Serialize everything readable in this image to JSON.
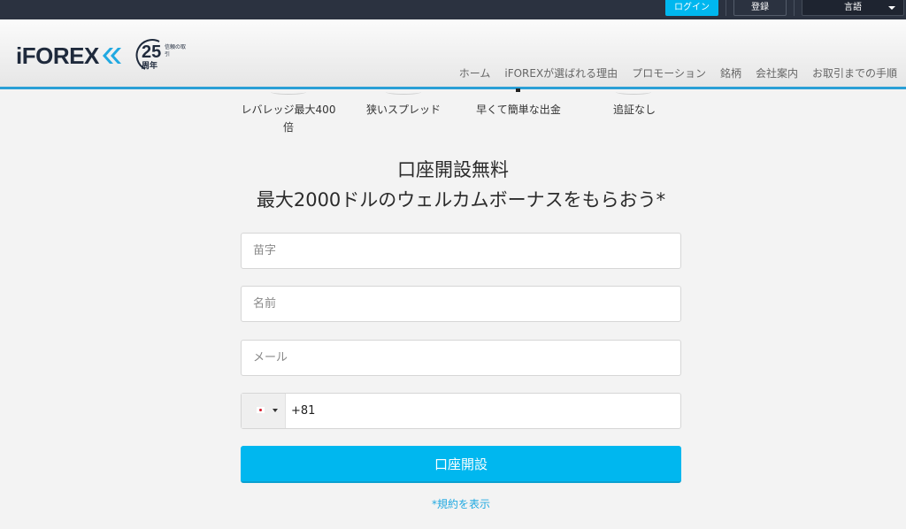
{
  "topbar": {
    "login_label": "ログイン",
    "register_label": "登録",
    "language_label": "言語"
  },
  "header": {
    "logo_text": "iFOREX",
    "badge_number": "25",
    "badge_sub": "周年",
    "badge_side": "信頼の取引",
    "nav": [
      "ホーム",
      "iFOREXが選ばれる理由",
      "プロモーション",
      "銘柄",
      "会社案内",
      "お取引までの手順"
    ]
  },
  "features": [
    "レバレッジ最大400倍",
    "狭いスプレッド",
    "早くて簡単な出金",
    "追証なし"
  ],
  "headline": {
    "line1": "口座開設無料",
    "line2": "最大2000ドルのウェルカムボーナスをもらおう*"
  },
  "form": {
    "last_name_placeholder": "苗字",
    "first_name_placeholder": "名前",
    "email_placeholder": "メール",
    "phone_value": "+81",
    "submit_label": "口座開設",
    "terms_link": "*規約を表示"
  },
  "colors": {
    "accent": "#00b7ef",
    "topbar": "#2b3240",
    "header_border": "#2a9fd6",
    "link": "#21a9e1"
  }
}
